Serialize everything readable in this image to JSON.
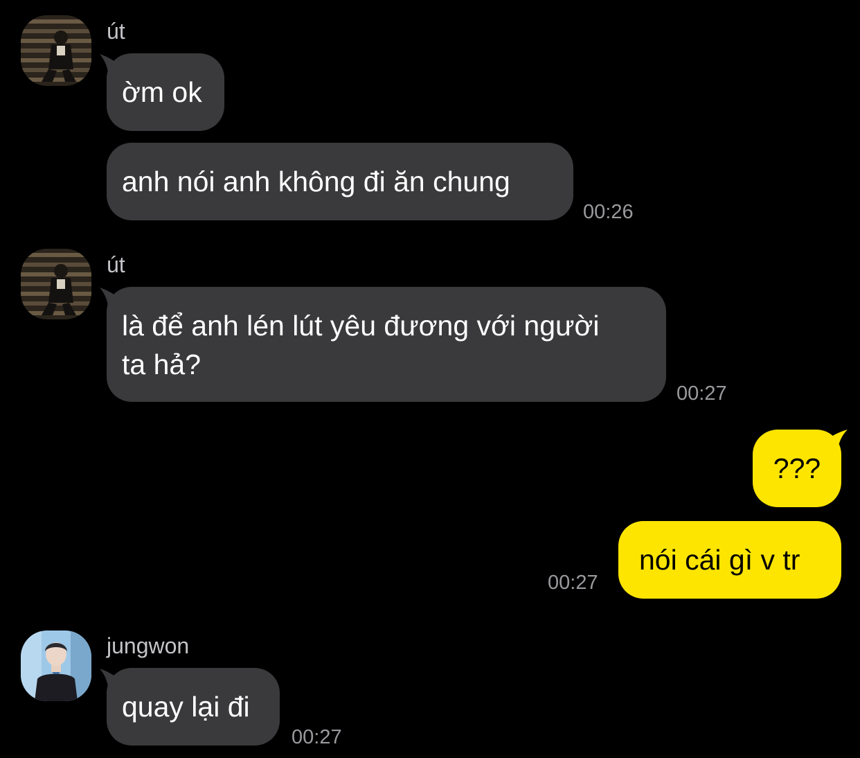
{
  "colors": {
    "background": "#000000",
    "incoming_bubble": "#3a3a3c",
    "outgoing_bubble": "#fee500",
    "sender_name": "#c4c4c8",
    "timestamp": "#9a9a9e"
  },
  "messages": {
    "group1": {
      "sender": "út",
      "avatar": "avatar-photo-ut",
      "bubble1": "ờm ok",
      "bubble2": "anh nói anh không đi ăn chung",
      "time": "00:26"
    },
    "group2": {
      "sender": "út",
      "avatar": "avatar-photo-ut",
      "bubble1_line1": "là để anh lén lút yêu đương với người",
      "bubble1_line2": "ta hả?",
      "time": "00:27"
    },
    "group3": {
      "bubble1": "???",
      "bubble2": "nói cái gì v tr",
      "time": "00:27"
    },
    "group4": {
      "sender": "jungwon",
      "avatar": "avatar-photo-jungwon",
      "bubble1": "quay lại đi",
      "time": "00:27"
    }
  }
}
